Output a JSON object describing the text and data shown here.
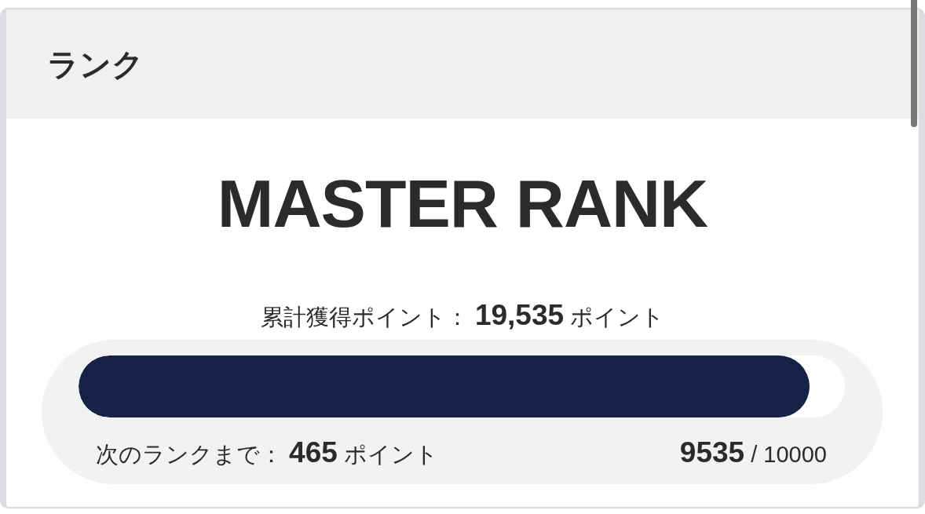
{
  "card": {
    "title": "ランク"
  },
  "rank": {
    "name": "MASTER RANK"
  },
  "total_points": {
    "text": "累計獲得ポイント： **19,535** ポイント"
  },
  "progress": {
    "level": 0.9535,
    "remaining": "次のランクまで： **465** ポイント",
    "count": "**9535** / 10000"
  }
}
